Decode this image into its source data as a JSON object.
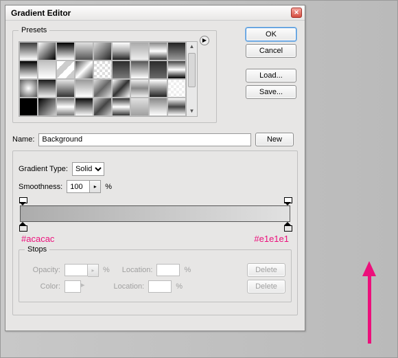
{
  "window": {
    "title": "Gradient Editor"
  },
  "buttons": {
    "ok": "OK",
    "cancel": "Cancel",
    "load": "Load...",
    "save": "Save...",
    "new": "New",
    "delete": "Delete"
  },
  "labels": {
    "presets": "Presets",
    "name": "Name:",
    "gradient_type": "Gradient Type:",
    "smoothness": "Smoothness:",
    "percent": "%",
    "stops": "Stops",
    "opacity": "Opacity:",
    "color": "Color:",
    "location": "Location:"
  },
  "fields": {
    "name_value": "Background",
    "gradient_type_value": "Solid",
    "smoothness_value": "100"
  },
  "gradient": {
    "stop_left_hex": "#acacac",
    "stop_right_hex": "#e1e1e1"
  },
  "presets": [
    {
      "bg": "linear-gradient(#3a3a3a,#fff)"
    },
    {
      "bg": "linear-gradient(135deg,#fff,#000)"
    },
    {
      "bg": "linear-gradient(#000,#fff)"
    },
    {
      "bg": "linear-gradient(#e0e0e0,#555)"
    },
    {
      "bg": "linear-gradient(135deg,#ddd,#222)"
    },
    {
      "bg": "linear-gradient(#fff,#aaa,#222)"
    },
    {
      "bg": "linear-gradient(#aaa,#eee)"
    },
    {
      "bg": "linear-gradient(#888,#fff,#333)"
    },
    {
      "bg": "linear-gradient(#222,#999)"
    },
    {
      "bg": "linear-gradient(#000,#fff)"
    },
    {
      "bg": "linear-gradient(#c0c0c0,#fff)"
    },
    {
      "bg": "linear-gradient(135deg,#fff 25%,#ccc 25%,#ccc 50%,#fff 50%,#fff 75%,#ccc 75%)"
    },
    {
      "bg": "linear-gradient(135deg,#444,#fff,#444)"
    },
    {
      "bg": "repeating-conic-gradient(#ddd 0 25%,#fff 0 50%) 0 0/8px 8px"
    },
    {
      "bg": "linear-gradient(#2b2b2b,#7a7a7a)"
    },
    {
      "bg": "linear-gradient(#555,#fff)"
    },
    {
      "bg": "linear-gradient(#2b2b2b,#6a6a6a)"
    },
    {
      "bg": "linear-gradient(#444,#fff,#000)"
    },
    {
      "bg": "radial-gradient(#fff,#555)"
    },
    {
      "bg": "linear-gradient(#1a1a1a,#eee)"
    },
    {
      "bg": "linear-gradient(#e6e6e6,#333)"
    },
    {
      "bg": "linear-gradient(#9a9a9a,#fff)"
    },
    {
      "bg": "linear-gradient(135deg,#ddd,#666,#ddd)"
    },
    {
      "bg": "linear-gradient(135deg,#fff,#333,#fff)"
    },
    {
      "bg": "linear-gradient(#eee,#888,#eee)"
    },
    {
      "bg": "linear-gradient(#fff,#222)"
    },
    {
      "bg": "repeating-conic-gradient(#eee 0 25%,#fff 0 50%) 0 0/8px 8px"
    },
    {
      "bg": "linear-gradient(#000,#000)"
    },
    {
      "bg": "linear-gradient(135deg,#000,#ccc)"
    },
    {
      "bg": "linear-gradient(#777,#fff,#777)"
    },
    {
      "bg": "linear-gradient(#0a0a0a,#fafafa)"
    },
    {
      "bg": "linear-gradient(135deg,#ccc,#444,#ccc)"
    },
    {
      "bg": "linear-gradient(#333,#fff,#333)"
    },
    {
      "bg": "linear-gradient(#e0e0e0,#a0a0a0)"
    },
    {
      "bg": "linear-gradient(#888,#fff)"
    },
    {
      "bg": "linear-gradient(#fff,#444,#fff)"
    }
  ]
}
